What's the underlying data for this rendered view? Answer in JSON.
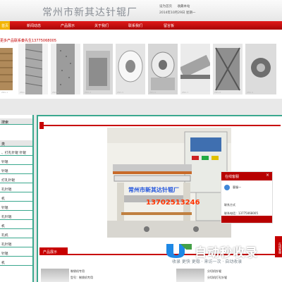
{
  "header": {
    "site_title": "常州市新其达针辊厂",
    "links": [
      "设为首页",
      "收藏本站"
    ],
    "date_text": "2014年10月29日 星期一"
  },
  "nav": {
    "items": [
      "首页",
      "新闻动态",
      "产品展示",
      "关于我们",
      "联系我们",
      "留言板"
    ],
    "active_index": 0
  },
  "strip": {
    "label": "更多产品联系秦先生13775068005",
    "thumb_captions": [
      "ZNS-1",
      "ZNS-2",
      "ZNS-3",
      "ZNS-4",
      "ZNS-5",
      "ZNS-6",
      "ZNS-7",
      "ZNS-8",
      "ZNS-9"
    ]
  },
  "sidebar": {
    "headers": [
      "搜索",
      "类"
    ],
    "items": [
      "、打孔针辊  针辊",
      "针辊",
      "针辊",
      "打孔针辊",
      "孔针辊",
      "机",
      "针辊",
      "孔针辊",
      "机",
      "孔机",
      "孔针辊",
      "针辊",
      "机"
    ]
  },
  "main": {
    "watermark_company": "常州市新其达针辊厂",
    "watermark_phone": "13702513246",
    "products_title": "产品展示",
    "product_captions": [
      "制袋机专用",
      "型号：制袋机专用",
      "分切机针辊",
      "分切机打孔针辊"
    ]
  },
  "service": {
    "title": "在线客服",
    "close": "×",
    "qq_label": "客服一",
    "contact_label": "联系方式",
    "phone_label": "联系电话：13775068005"
  },
  "side_tab": "在线客服",
  "watermark": {
    "text": "自动秒收录",
    "subtext": "收录 更快 更稳 · 来访一次 · 自动收录"
  },
  "colors": {
    "brand_red": "#c80000",
    "nav_active": "#f3b400",
    "frame_green": "#3aa88e"
  }
}
